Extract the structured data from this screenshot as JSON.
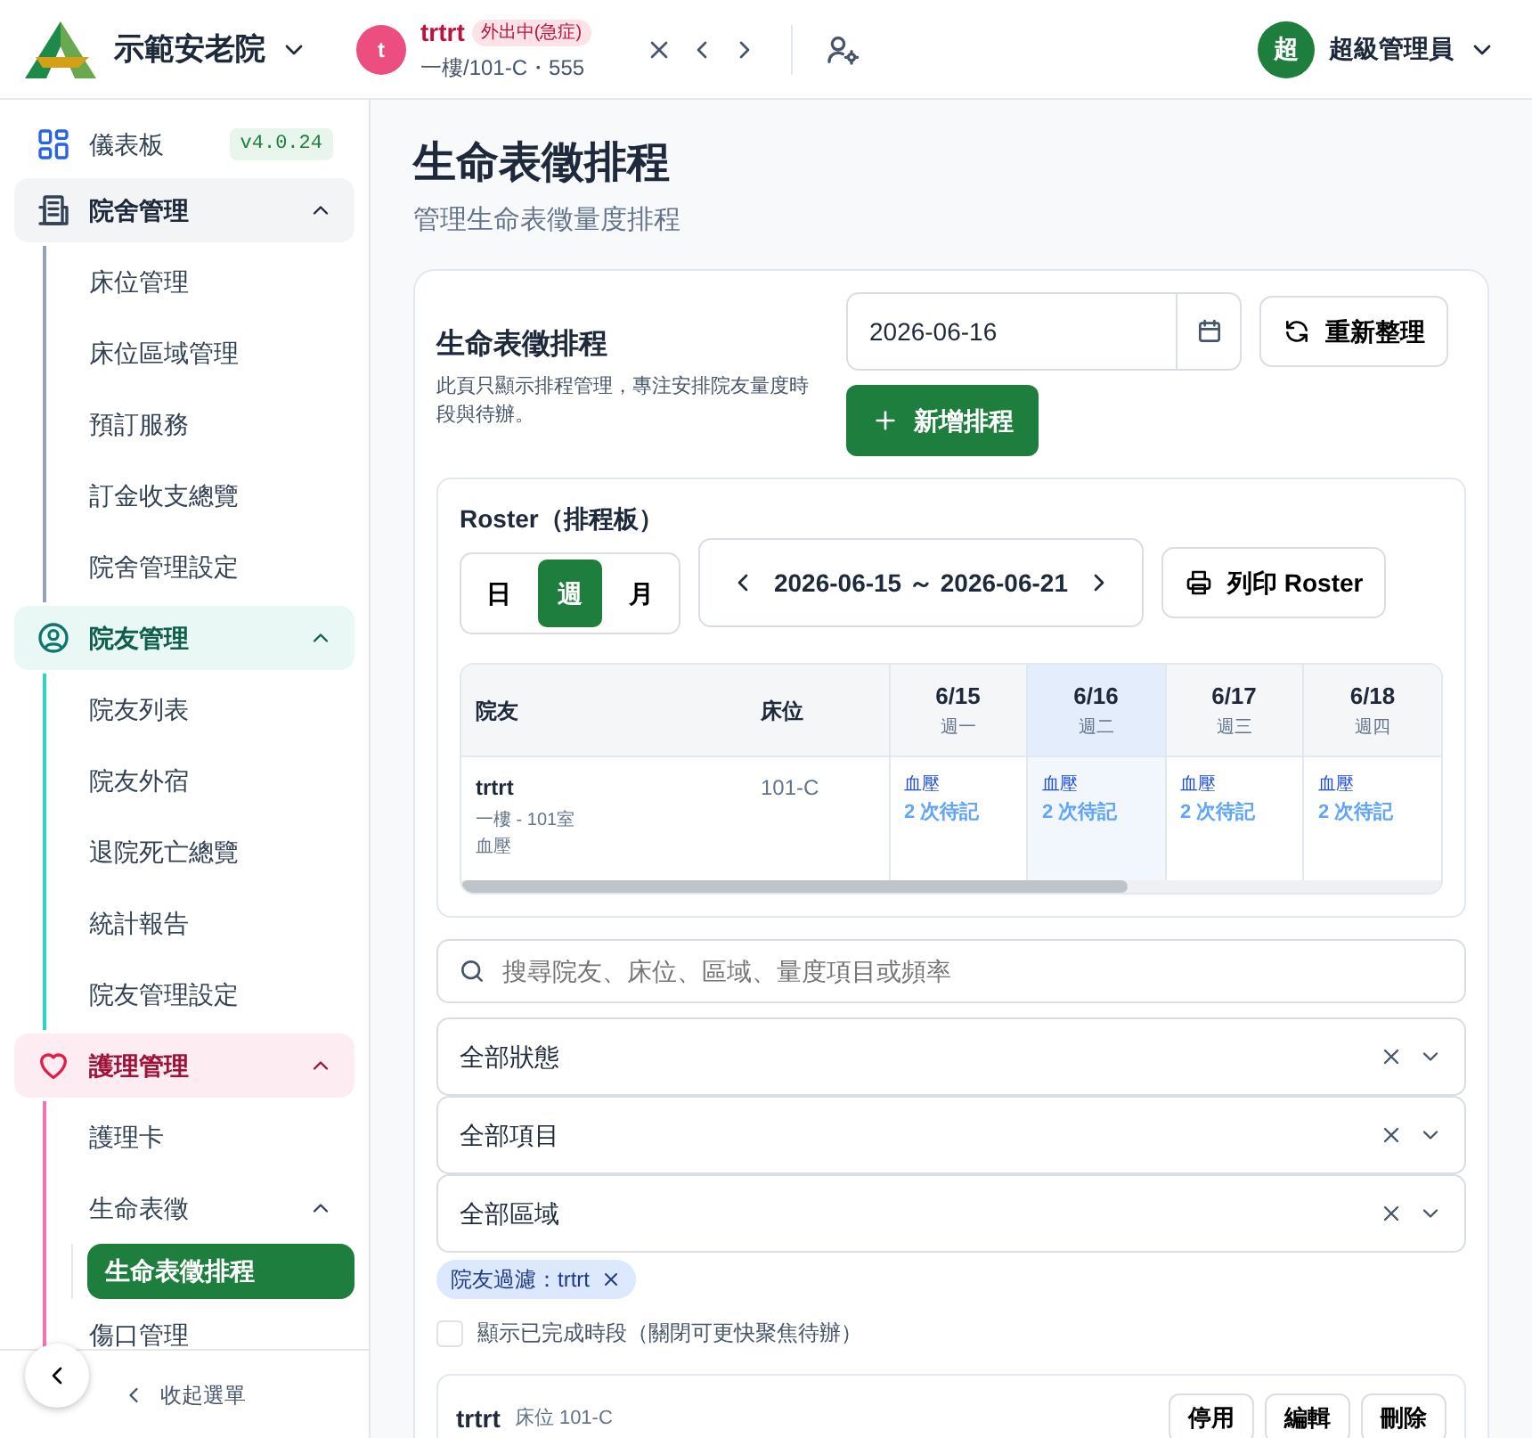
{
  "header": {
    "brand": "示範安老院",
    "patient": {
      "avatar": "t",
      "name": "trtrt",
      "status": "外出中(急症)",
      "location": "一樓/101-C・555"
    },
    "user": {
      "avatar": "超",
      "name": "超級管理員"
    }
  },
  "sidebar": {
    "dashboard": {
      "label": "儀表板",
      "version": "v4.0.24"
    },
    "groups": [
      {
        "label": "院舍管理",
        "kind": "building",
        "color": "#94a3b8",
        "expanded": true,
        "children": [
          {
            "label": "床位管理",
            "selected": false
          },
          {
            "label": "床位區域管理",
            "selected": false
          },
          {
            "label": "預訂服務",
            "selected": false
          },
          {
            "label": "訂金收支總覽",
            "selected": false
          },
          {
            "label": "院舍管理設定",
            "selected": false
          }
        ]
      },
      {
        "label": "院友管理",
        "kind": "person",
        "color": "#2dd4bf",
        "expanded": true,
        "children": [
          {
            "label": "院友列表",
            "selected": false
          },
          {
            "label": "院友外宿",
            "selected": false
          },
          {
            "label": "退院死亡總覽",
            "selected": false
          },
          {
            "label": "統計報告",
            "selected": false
          },
          {
            "label": "院友管理設定",
            "selected": false
          }
        ]
      },
      {
        "label": "護理管理",
        "kind": "heart",
        "color": "#f472b6",
        "expanded": true,
        "children": [
          {
            "label": "護理卡",
            "selected": false
          },
          {
            "label": "生命表徵",
            "selected": false,
            "expanded": true,
            "children": [
              {
                "label": "生命表徵排程",
                "selected": true
              }
            ]
          },
          {
            "label": "傷口管理",
            "selected": false
          }
        ]
      }
    ],
    "collapse": "收起選單"
  },
  "page": {
    "title": "生命表徵排程",
    "subtitle": "管理生命表徵量度排程"
  },
  "schedule_card": {
    "title": "生命表徵排程",
    "description": "此頁只顯示排程管理，專注安排院友量度時段與待辦。",
    "date": "2026-06-16",
    "refresh": "重新整理",
    "add": "新增排程"
  },
  "roster": {
    "title": "Roster（排程板）",
    "views": [
      {
        "label": "日",
        "selected": false
      },
      {
        "label": "週",
        "selected": true
      },
      {
        "label": "月",
        "selected": false
      }
    ],
    "range": "2026-06-15 ～ 2026-06-21",
    "print": "列印 Roster",
    "columns": [
      "院友",
      "床位"
    ],
    "days": [
      {
        "date": "6/15",
        "weekday": "週一",
        "selected": false
      },
      {
        "date": "6/16",
        "weekday": "週二",
        "selected": true
      },
      {
        "date": "6/17",
        "weekday": "週三",
        "selected": false
      },
      {
        "date": "6/18",
        "weekday": "週四",
        "selected": false
      }
    ],
    "rows": [
      {
        "name": "trtrt",
        "location": "一樓 - 101室",
        "item": "血壓",
        "bed": "101-C",
        "cells": [
          {
            "item": "血壓",
            "count": "2 次待記"
          },
          {
            "item": "血壓",
            "count": "2 次待記"
          },
          {
            "item": "血壓",
            "count": "2 次待記"
          },
          {
            "item": "血壓",
            "count": "2 次待記"
          }
        ]
      }
    ]
  },
  "search": {
    "placeholder": "搜尋院友、床位、區域、量度項目或頻率"
  },
  "filters": [
    "全部狀態",
    "全部項目",
    "全部區域"
  ],
  "chip": "院友過濾：trtrt",
  "show_completed": {
    "label": "顯示已完成時段（關閉可更快聚焦待辦）",
    "checked": false
  },
  "schedule_item": {
    "name": "trtrt",
    "bed": "床位 101-C",
    "buttons": [
      "停用",
      "編輯",
      "刪除"
    ]
  }
}
